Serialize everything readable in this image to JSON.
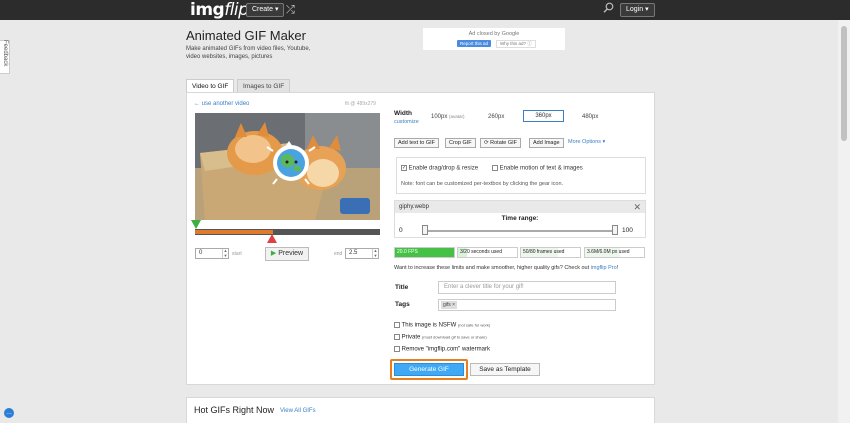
{
  "header": {
    "logo_main": "img",
    "logo_flip": "flip",
    "create_label": "Create ▾",
    "login_label": "Login ▾"
  },
  "feedback_label": "Feedback",
  "page": {
    "title": "Animated GIF Maker",
    "description": "Make animated GIFs from video files, Youtube, video websites, images, pictures"
  },
  "ad": {
    "closed_text": "Ad closed by Google",
    "report_label": "Report this ad",
    "why_label": "Why this ad? ⓘ"
  },
  "tabs": [
    {
      "label": "Video to GIF",
      "active": true
    },
    {
      "label": "Images to GIF",
      "active": false
    }
  ],
  "video": {
    "use_another": "← use another video",
    "fps_info": "fit @ 489x279"
  },
  "timeline": {
    "start_value": "0",
    "start_label": "start",
    "end_label": "end",
    "end_value": "2.5",
    "preview_label": "Preview",
    "range_fraction": 0.42
  },
  "width": {
    "label": "Width",
    "customize": "customize",
    "options": [
      "100px",
      "260px",
      "360px",
      "480px"
    ],
    "avatar_note": "(avatar)",
    "selected": "360px"
  },
  "tools": {
    "add_text": "Add text to GIF",
    "crop": "Crop GIF",
    "rotate": "Rotate GIF",
    "add_image": "Add Image",
    "more_options": "More Options ▾"
  },
  "options": {
    "drag_drop": "Enable drag/drop & resize",
    "motion": "Enable motion of text & images",
    "note": "Note: font can be customized per-textbox by clicking the gear icon."
  },
  "range_panel": {
    "file_name": "giphy.webp",
    "title": "Time range:",
    "start": "0",
    "end": "100",
    "start_fraction": 0.0,
    "end_fraction": 1.0
  },
  "stats": {
    "fps": "20.0 FPS",
    "seconds": "3/20 seconds used",
    "frames": "50/80 frames used",
    "size": "3.6M/6.0M px used",
    "fps_fill": 1.0,
    "seconds_fill": 0.15,
    "frames_fill": 0.625,
    "size_fill": 0.6
  },
  "limits": {
    "text": "Want to increase these limits and make smoother, higher quality gifs? Check out ",
    "link": "imgflip Pro",
    "suffix": "!"
  },
  "form": {
    "title_label": "Title",
    "title_placeholder": "Enter a clever title for your gif!",
    "tags_label": "Tags",
    "tag_value": "gifs ×"
  },
  "checkboxes": {
    "nsfw": "This image is NSFW",
    "nsfw_note": "(not safe for work)",
    "private": "Private",
    "private_note": "(must download gif to save or share)",
    "watermark": "Remove \"imgflip.com\" watermark"
  },
  "buttons": {
    "generate": "Generate GIF",
    "save_template": "Save as Template"
  },
  "hot": {
    "title": "Hot GIFs Right Now",
    "view_all": "View All GIFs"
  },
  "colors": {
    "topbar": "#2c2c2c",
    "accent_blue": "#3fa9f5",
    "highlight_orange": "#e67e22",
    "fps_green": "#45c246",
    "range_orange": "#e07a2c"
  }
}
